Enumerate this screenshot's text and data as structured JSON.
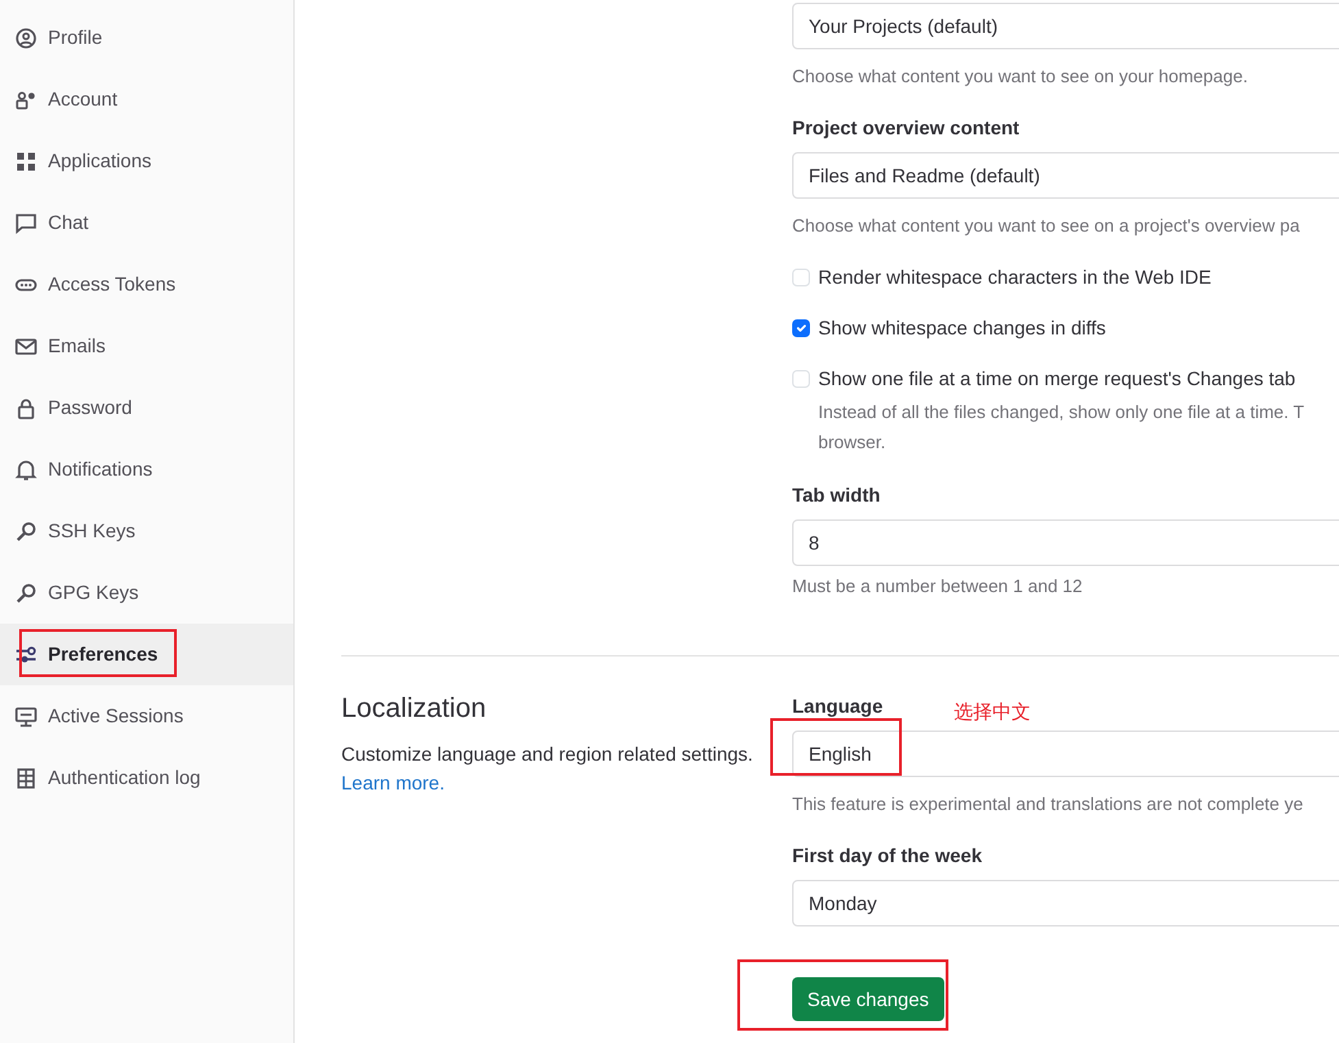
{
  "sidebar": {
    "items": [
      {
        "label": "Profile",
        "selected": false
      },
      {
        "label": "Account",
        "selected": false
      },
      {
        "label": "Applications",
        "selected": false
      },
      {
        "label": "Chat",
        "selected": false
      },
      {
        "label": "Access Tokens",
        "selected": false
      },
      {
        "label": "Emails",
        "selected": false
      },
      {
        "label": "Password",
        "selected": false
      },
      {
        "label": "Notifications",
        "selected": false
      },
      {
        "label": "SSH Keys",
        "selected": false
      },
      {
        "label": "GPG Keys",
        "selected": false
      },
      {
        "label": "Preferences",
        "selected": true
      },
      {
        "label": "Active Sessions",
        "selected": false
      },
      {
        "label": "Authentication log",
        "selected": false
      }
    ]
  },
  "behavior": {
    "homepage": {
      "value": "Your Projects (default)",
      "help": "Choose what content you want to see on your homepage."
    },
    "project_overview": {
      "label": "Project overview content",
      "value": "Files and Readme (default)",
      "help": "Choose what content you want to see on a project's overview pa"
    },
    "checkboxes": [
      {
        "label": "Render whitespace characters in the Web IDE",
        "checked": false
      },
      {
        "label": "Show whitespace changes in diffs",
        "checked": true
      },
      {
        "label": "Show one file at a time on merge request's Changes tab",
        "checked": false,
        "help_lines": [
          "Instead of all the files changed, show only one file at a time. T",
          "browser."
        ]
      }
    ],
    "tab_width": {
      "label": "Tab width",
      "value": "8",
      "help": "Must be a number between 1 and 12"
    }
  },
  "localization": {
    "title": "Localization",
    "description": "Customize language and region related settings.",
    "link": "Learn more.",
    "language": {
      "label": "Language",
      "value": "English",
      "help": "This feature is experimental and translations are not complete ye"
    },
    "first_day": {
      "label": "First day of the week",
      "value": "Monday"
    }
  },
  "save_button": "Save changes",
  "annotation": {
    "note": "选择中文"
  }
}
